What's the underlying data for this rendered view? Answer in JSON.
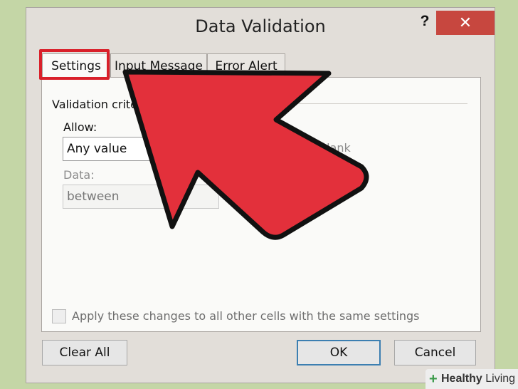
{
  "dialog": {
    "title": "Data Validation",
    "help": "?",
    "close": "✕"
  },
  "tabs": [
    {
      "label": "Settings",
      "active": true
    },
    {
      "label": "Input Message",
      "active": false
    },
    {
      "label": "Error Alert",
      "active": false
    }
  ],
  "settings": {
    "group_label": "Validation criter",
    "allow_label": "Allow:",
    "allow_value": "Any value",
    "data_label": "Data:",
    "data_value": "between",
    "ignore_blank_label": "blank",
    "apply_label": "Apply these changes to all other cells with the same settings",
    "apply_checked": false
  },
  "buttons": {
    "clear_all": "Clear All",
    "ok": "OK",
    "cancel": "Cancel"
  },
  "annotation": {
    "highlight_color": "#d9202a",
    "arrow_color": "#e3303b"
  },
  "watermark": {
    "brand_bold": "Healthy",
    "brand_rest": " Living"
  }
}
